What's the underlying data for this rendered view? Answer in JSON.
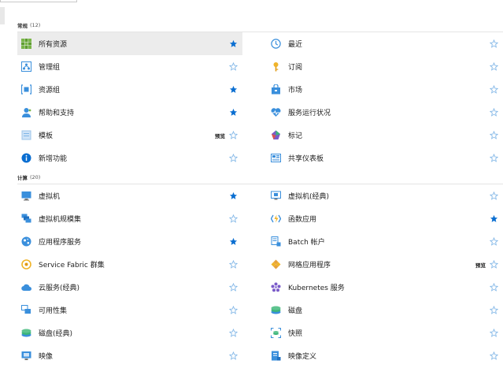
{
  "colors": {
    "star_on": "#0a6ed1",
    "star_off": "#7fb5e6",
    "accent": "#0078d4"
  },
  "sections": [
    {
      "title": "常规",
      "count": "(12)",
      "items": [
        {
          "label": "所有资源",
          "icon": "all-resources-icon",
          "favorite": true,
          "selected": true
        },
        {
          "label": "最近",
          "icon": "clock-icon",
          "favorite": false
        },
        {
          "label": "管理组",
          "icon": "management-group-icon",
          "favorite": false
        },
        {
          "label": "订阅",
          "icon": "key-icon",
          "favorite": false
        },
        {
          "label": "资源组",
          "icon": "resource-group-icon",
          "favorite": true
        },
        {
          "label": "市场",
          "icon": "marketplace-icon",
          "favorite": false
        },
        {
          "label": "帮助和支持",
          "icon": "help-support-icon",
          "favorite": true
        },
        {
          "label": "服务运行状况",
          "icon": "heart-pulse-icon",
          "favorite": false
        },
        {
          "label": "模板",
          "icon": "template-icon",
          "favorite": false,
          "badge": "预览"
        },
        {
          "label": "标记",
          "icon": "tag-icon",
          "favorite": false
        },
        {
          "label": "新增功能",
          "icon": "info-icon",
          "favorite": false
        },
        {
          "label": "共享仪表板",
          "icon": "dashboard-icon",
          "favorite": false
        }
      ]
    },
    {
      "title": "计算",
      "count": "(20)",
      "items": [
        {
          "label": "虚拟机",
          "icon": "virtual-machine-icon",
          "favorite": true
        },
        {
          "label": "虚拟机(经典)",
          "icon": "virtual-machine-classic-icon",
          "favorite": false
        },
        {
          "label": "虚拟机规模集",
          "icon": "vm-scale-set-icon",
          "favorite": false
        },
        {
          "label": "函数应用",
          "icon": "function-app-icon",
          "favorite": true
        },
        {
          "label": "应用程序服务",
          "icon": "app-service-icon",
          "favorite": true
        },
        {
          "label": "Batch 帐户",
          "icon": "batch-icon",
          "favorite": false
        },
        {
          "label": "Service Fabric 群集",
          "icon": "service-fabric-icon",
          "favorite": false
        },
        {
          "label": "网格应用程序",
          "icon": "mesh-app-icon",
          "favorite": false,
          "badge": "预览"
        },
        {
          "label": "云服务(经典)",
          "icon": "cloud-service-icon",
          "favorite": false
        },
        {
          "label": "Kubernetes 服务",
          "icon": "kubernetes-icon",
          "favorite": false
        },
        {
          "label": "可用性集",
          "icon": "availability-set-icon",
          "favorite": false
        },
        {
          "label": "磁盘",
          "icon": "disk-icon",
          "favorite": false
        },
        {
          "label": "磁盘(经典)",
          "icon": "disk-classic-icon",
          "favorite": false
        },
        {
          "label": "快照",
          "icon": "snapshot-icon",
          "favorite": false
        },
        {
          "label": "映像",
          "icon": "image-icon",
          "favorite": false
        },
        {
          "label": "映像定义",
          "icon": "image-definition-icon",
          "favorite": false
        }
      ]
    }
  ]
}
